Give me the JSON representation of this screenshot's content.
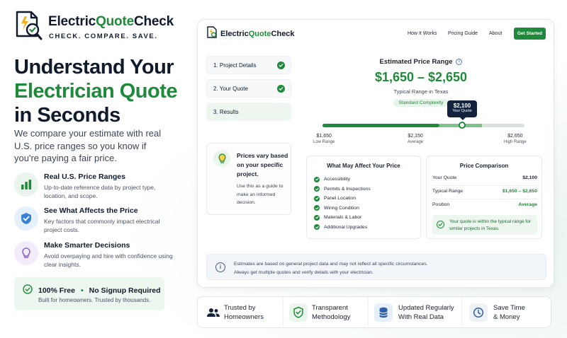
{
  "brand": {
    "name_part1": "Electric",
    "name_part2": "Quote",
    "name_part3": "Check",
    "tagline": "CHECK. COMPARE. SAVE."
  },
  "hero": {
    "line1": "Understand Your",
    "line2": "Electrician Quote",
    "line3": "in Seconds",
    "subtitle": "We compare your estimate with real U.S. price ranges so you know if you're paying a fair price."
  },
  "features": [
    {
      "title": "Real U.S. Price Ranges",
      "desc": "Up-to-date reference data by project type, location, and scope.",
      "icon": "bar-chart-icon"
    },
    {
      "title": "See What Affects the Price",
      "desc": "Key factors that commonly impact electrical project costs.",
      "icon": "shield-check-icon"
    },
    {
      "title": "Make Smarter Decisions",
      "desc": "Avoid overpaying and hire with confidence using clear insights.",
      "icon": "lightbulb-icon"
    }
  ],
  "free_box": {
    "part1": "100% Free",
    "separator": "•",
    "part2": "No Signup Required",
    "sub": "Built for homeowners. Trusted by thousands."
  },
  "app": {
    "nav": {
      "how": "How It Works",
      "pricing": "Pricing Guide",
      "about": "About",
      "cta": "Get Started"
    },
    "steps": [
      {
        "label": "1. Project Details",
        "done": true
      },
      {
        "label": "2. Your Quote",
        "done": true
      },
      {
        "label": "3. Results",
        "done": false
      }
    ],
    "tip": {
      "heading": "Prices vary based on your specific project.",
      "body": "Use this as a guide to make an informed decision."
    },
    "estimate": {
      "label": "Estimated Price Range",
      "info_icon": "i",
      "range": "$1,650 – $2,650",
      "subtitle": "Typical Range in Texas",
      "badge": "Standard Complexity",
      "quote_tag_value": "$2,100",
      "quote_tag_label": "Your Quote",
      "scale": [
        {
          "value": "$1,650",
          "label": "Low Range"
        },
        {
          "value": "$2,150",
          "label": "Average"
        },
        {
          "value": "$2,650",
          "label": "High Range"
        }
      ],
      "bar_fill_fraction": 0.58,
      "quote_position_fraction": 0.69,
      "accent_color": "#1f8a3b"
    },
    "factors": {
      "title": "What May Affect Your Price",
      "items": [
        "Accessibility",
        "Permits & Inspections",
        "Panel Location",
        "Wiring Condition",
        "Materials & Labor",
        "Additional Upgrades"
      ]
    },
    "comparison": {
      "title": "Price Comparison",
      "rows": [
        {
          "label": "Your Quote",
          "value": "$2,100"
        },
        {
          "label": "Typical Range",
          "value": "$1,650 – $2,650"
        },
        {
          "label": "Position",
          "value": "Average"
        }
      ],
      "note": "Your quote is within the typical range for similar projects in Texas."
    },
    "disclaimer": {
      "line1": "Estimates are based on general project data and may not reflect all specific circumstances.",
      "line2": "Always get multiple quotes and verify details with your electrician."
    }
  },
  "trust": [
    {
      "line1": "Trusted by",
      "line2": "Homeowners",
      "icon": "users-icon"
    },
    {
      "line1": "Transparent",
      "line2": "Methodology",
      "icon": "shield-check-icon"
    },
    {
      "line1": "Updated Regularly",
      "line2": "With Real Data",
      "icon": "database-icon"
    },
    {
      "line1": "Save Time",
      "line2": "& Money",
      "icon": "clock-icon"
    }
  ]
}
